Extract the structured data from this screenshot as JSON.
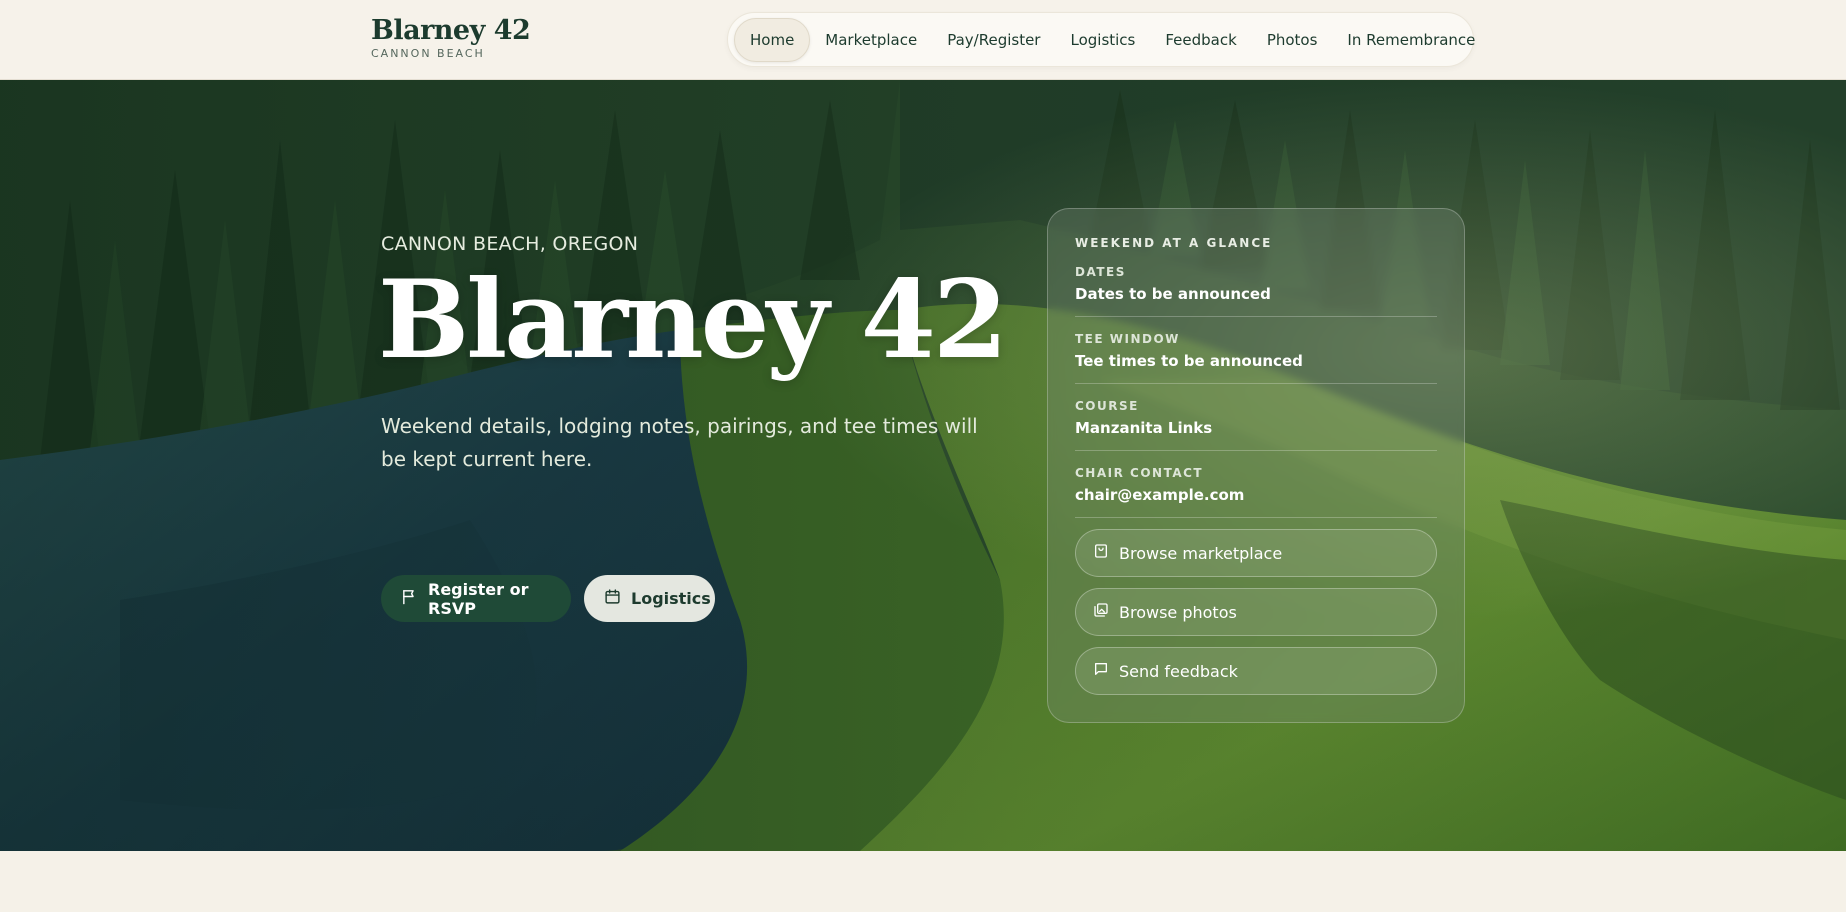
{
  "brand": {
    "title": "Blarney 42",
    "subtitle": "CANNON BEACH"
  },
  "nav": {
    "items": [
      {
        "label": "Home",
        "active": true
      },
      {
        "label": "Marketplace",
        "active": false
      },
      {
        "label": "Pay/Register",
        "active": false
      },
      {
        "label": "Logistics",
        "active": false
      },
      {
        "label": "Feedback",
        "active": false
      },
      {
        "label": "Photos",
        "active": false
      },
      {
        "label": "In Remembrance",
        "active": false
      }
    ]
  },
  "hero": {
    "eyebrow": "CANNON BEACH, OREGON",
    "title": "Blarney 42",
    "description": "Weekend details, lodging notes, pairings, and tee times will be kept current here.",
    "primary_button": {
      "label": "Register or RSVP",
      "icon": "flag-icon"
    },
    "secondary_button": {
      "label": "Logistics",
      "icon": "calendar-icon"
    }
  },
  "glance": {
    "heading": "WEEKEND AT A GLANCE",
    "rows": [
      {
        "label": "DATES",
        "value": "Dates to be announced"
      },
      {
        "label": "TEE WINDOW",
        "value": "Tee times to be announced"
      },
      {
        "label": "COURSE",
        "value": "Manzanita Links"
      },
      {
        "label": "CHAIR CONTACT",
        "value": "chair@example.com"
      }
    ],
    "links": [
      {
        "label": "Browse marketplace",
        "icon": "shopping-bag-icon"
      },
      {
        "label": "Browse photos",
        "icon": "photos-icon"
      },
      {
        "label": "Send feedback",
        "icon": "message-icon"
      }
    ]
  },
  "colors": {
    "brand_green": "#1c3b2e",
    "primary_button": "#1f4a37",
    "page_background": "#f5f1e8"
  }
}
